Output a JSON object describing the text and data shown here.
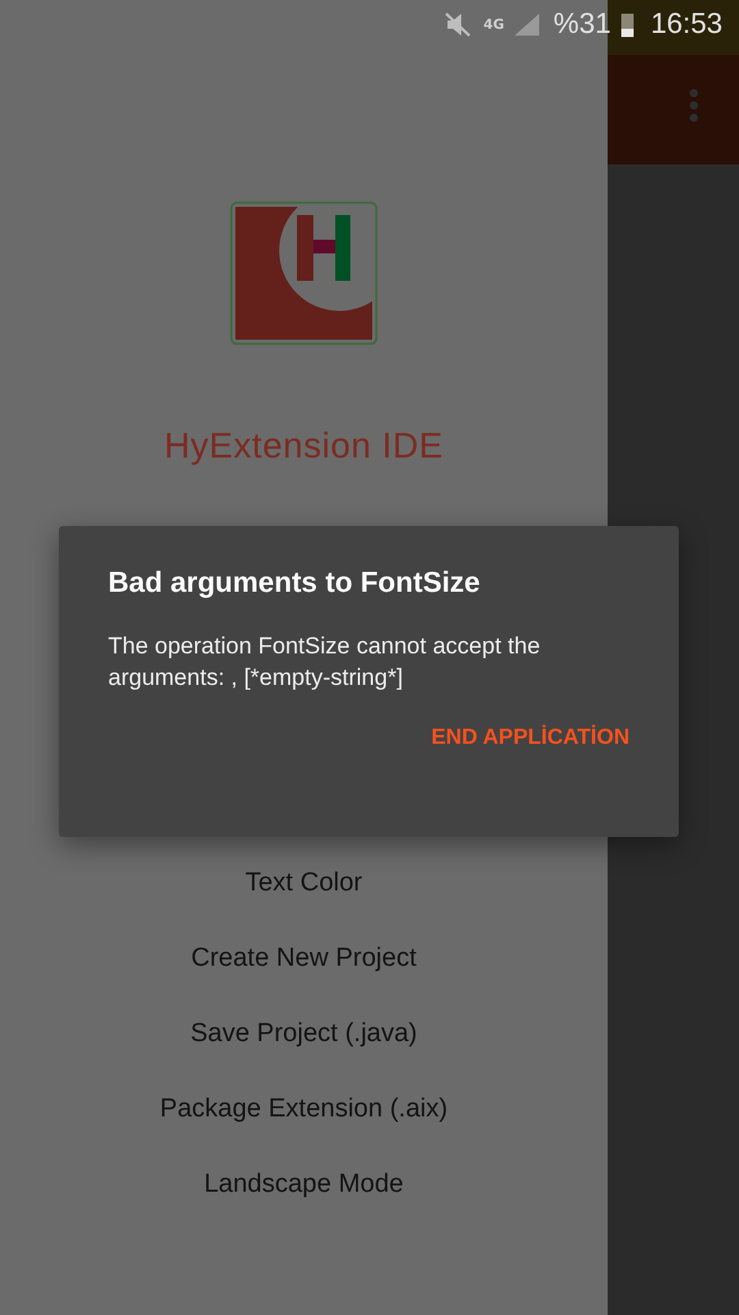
{
  "status_bar": {
    "network": "4G",
    "battery": "%31",
    "time": "16:53"
  },
  "drawer": {
    "title": "HyExtension IDE",
    "items": [
      {
        "label": "Text Color"
      },
      {
        "label": "Create New Project"
      },
      {
        "label": "Save Project (.java)"
      },
      {
        "label": "Package Extension (.aix)"
      },
      {
        "label": "Landscape Mode"
      }
    ]
  },
  "dialog": {
    "title": "Bad arguments to FontSize",
    "message": "The operation FontSize cannot accept the arguments: , [*empty-string*]",
    "buttons": [
      "END APPLİCATİON"
    ]
  }
}
